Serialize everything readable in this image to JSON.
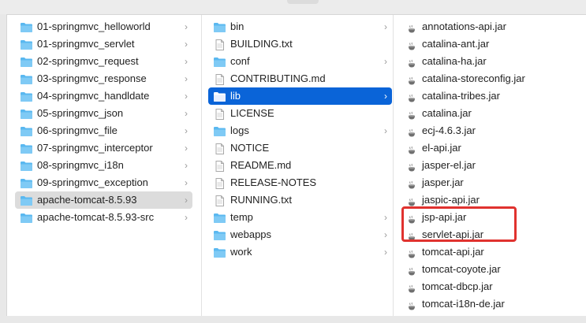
{
  "col1": {
    "items": [
      {
        "label": "01-springmvc_helloworld"
      },
      {
        "label": "01-springmvc_servlet"
      },
      {
        "label": "02-springmvc_request"
      },
      {
        "label": "03-springmvc_response"
      },
      {
        "label": "04-springmvc_handldate"
      },
      {
        "label": "05-springmvc_json"
      },
      {
        "label": "06-springmvc_file"
      },
      {
        "label": "07-springmvc_interceptor"
      },
      {
        "label": "08-springmvc_i18n"
      },
      {
        "label": "09-springmvc_exception"
      },
      {
        "label": "apache-tomcat-8.5.93"
      },
      {
        "label": "apache-tomcat-8.5.93-src"
      }
    ],
    "selected": "apache-tomcat-8.5.93"
  },
  "col2": {
    "items": [
      {
        "label": "bin",
        "kind": "folder"
      },
      {
        "label": "BUILDING.txt",
        "kind": "file"
      },
      {
        "label": "conf",
        "kind": "folder"
      },
      {
        "label": "CONTRIBUTING.md",
        "kind": "file"
      },
      {
        "label": "lib",
        "kind": "folder"
      },
      {
        "label": "LICENSE",
        "kind": "file"
      },
      {
        "label": "logs",
        "kind": "folder"
      },
      {
        "label": "NOTICE",
        "kind": "file"
      },
      {
        "label": "README.md",
        "kind": "file"
      },
      {
        "label": "RELEASE-NOTES",
        "kind": "file"
      },
      {
        "label": "RUNNING.txt",
        "kind": "file"
      },
      {
        "label": "temp",
        "kind": "folder"
      },
      {
        "label": "webapps",
        "kind": "folder"
      },
      {
        "label": "work",
        "kind": "folder"
      }
    ],
    "selected": "lib"
  },
  "col3": {
    "items": [
      {
        "label": "annotations-api.jar"
      },
      {
        "label": "catalina-ant.jar"
      },
      {
        "label": "catalina-ha.jar"
      },
      {
        "label": "catalina-storeconfig.jar"
      },
      {
        "label": "catalina-tribes.jar"
      },
      {
        "label": "catalina.jar"
      },
      {
        "label": "ecj-4.6.3.jar"
      },
      {
        "label": "el-api.jar"
      },
      {
        "label": "jasper-el.jar"
      },
      {
        "label": "jasper.jar"
      },
      {
        "label": "jaspic-api.jar"
      },
      {
        "label": "jsp-api.jar"
      },
      {
        "label": "servlet-api.jar"
      },
      {
        "label": "tomcat-api.jar"
      },
      {
        "label": "tomcat-coyote.jar"
      },
      {
        "label": "tomcat-dbcp.jar"
      },
      {
        "label": "tomcat-i18n-de.jar"
      }
    ]
  },
  "icons": {
    "folder": "folder-icon",
    "file": "document-icon",
    "jar": "jar-icon",
    "chevron": "chevron-right-icon"
  },
  "colors": {
    "folder": "#5ab8f0",
    "selection_blue": "#0a64d8",
    "selection_gray": "#dcdcdc",
    "highlight": "#e0322f"
  }
}
